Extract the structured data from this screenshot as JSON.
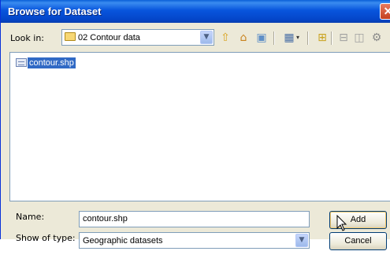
{
  "window": {
    "title": "Browse for Dataset",
    "close_glyph": "✕"
  },
  "lookin": {
    "label": "Look in:",
    "value": "02 Contour data",
    "icon": "folder-icon",
    "dropdown_glyph": "▼"
  },
  "toolbar": {
    "up_glyph": "⇧",
    "home_glyph": "⌂",
    "catalog_glyph": "▣",
    "views_glyph": "▦",
    "views_arrow": "▾",
    "connect_glyph": "⊞",
    "disconnect_glyph": "⊟",
    "new_glyph": "◫",
    "tools_glyph": "⚙"
  },
  "files": {
    "items": [
      {
        "name": "contour.shp",
        "icon": "shapefile-icon",
        "selected": true
      }
    ]
  },
  "form": {
    "name_label": "Name:",
    "name_value": "contour.shp",
    "type_label": "Show of type:",
    "type_value": "Geographic datasets",
    "type_dropdown_glyph": "▼"
  },
  "buttons": {
    "add": "Add",
    "cancel": "Cancel"
  },
  "colors": {
    "titlebar": "#0855dd",
    "selection": "#316ac5",
    "dialog_bg": "#ece9d8"
  }
}
